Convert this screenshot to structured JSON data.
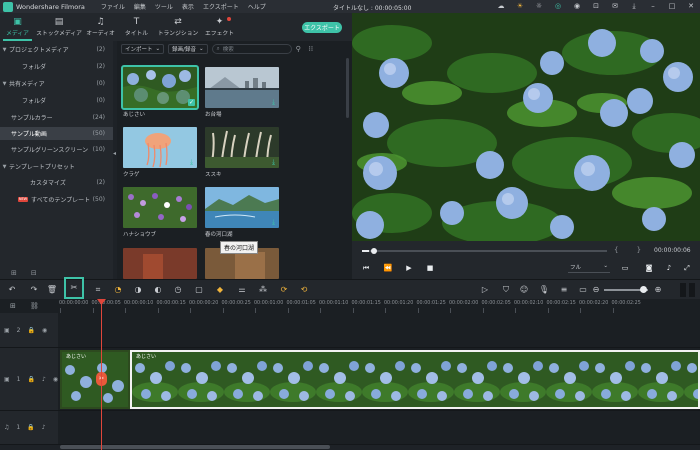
{
  "app": {
    "name": "Wondershare Filmora",
    "window_title": "タイトルなし : 00:00:05:00"
  },
  "menu": [
    "ファイル",
    "編集",
    "ツール",
    "表示",
    "エクスポート",
    "ヘルプ"
  ],
  "tabs": [
    {
      "label": "メディア",
      "glyph": "▣"
    },
    {
      "label": "ストックメディア",
      "glyph": "▤"
    },
    {
      "label": "オーディオ",
      "glyph": "♫"
    },
    {
      "label": "タイトル",
      "glyph": "T"
    },
    {
      "label": "トランジション",
      "glyph": "⇄"
    },
    {
      "label": "エフェクト",
      "glyph": "✦"
    }
  ],
  "export_label": "エクスポート",
  "tree": [
    {
      "label": "プロジェクトメディア",
      "count": "(2)",
      "arrow": "▼"
    },
    {
      "label": "フォルダ",
      "count": "(2)",
      "arrow": ""
    },
    {
      "label": "共有メディア",
      "count": "(0)",
      "arrow": "▼"
    },
    {
      "label": "フォルダ",
      "count": "(0)",
      "arrow": ""
    },
    {
      "label": "サンプルカラー",
      "count": "(24)",
      "arrow": ""
    },
    {
      "label": "サンプル動画",
      "count": "(50)",
      "arrow": ""
    },
    {
      "label": "サンプルグリーンスクリーン",
      "count": "(10)",
      "arrow": ""
    },
    {
      "label": "テンプレートプリセット",
      "count": "",
      "arrow": "▼"
    },
    {
      "label": "カスタマイズ",
      "count": "(2)",
      "arrow": ""
    },
    {
      "label": "すべてのテンプレート",
      "count": "(50)",
      "arrow": "",
      "badge": "NEW"
    }
  ],
  "filters": {
    "import": "インポート",
    "record": "録画/録音",
    "search_placeholder": "検索"
  },
  "thumbs": [
    {
      "label": "あじさい",
      "selected": true
    },
    {
      "label": "お台場",
      "selected": false
    },
    {
      "label": "クラゲ",
      "selected": false
    },
    {
      "label": "ススキ",
      "selected": false
    },
    {
      "label": "ハナショウブ",
      "selected": false
    },
    {
      "label": "春の河口湖",
      "selected": false
    }
  ],
  "tooltip": "春の河口湖",
  "player": {
    "time": "00:00:00:06",
    "quality": "フル",
    "progress": 0.03
  },
  "ruler_labels": [
    "00:00:00:00",
    "00:00:00:05",
    "00:00:00:10",
    "00:00:00:15",
    "00:00:00:20",
    "00:00:00:25",
    "00:00:01:00",
    "00:00:01:05",
    "00:00:01:10",
    "00:00:01:15",
    "00:00:01:20",
    "00:00:01:25",
    "00:00:02:00",
    "00:00:02:05",
    "00:00:02:10",
    "00:00:02:15",
    "00:00:02:20",
    "00:00:02:25"
  ],
  "tracks": [
    {
      "label": "2"
    },
    {
      "label": "1"
    },
    {
      "label": "1"
    }
  ],
  "clips": [
    {
      "title": "あじさい"
    },
    {
      "title": "あじさい"
    }
  ],
  "colors": {
    "accent": "#3ec3a8",
    "playhead": "#e0463b"
  }
}
